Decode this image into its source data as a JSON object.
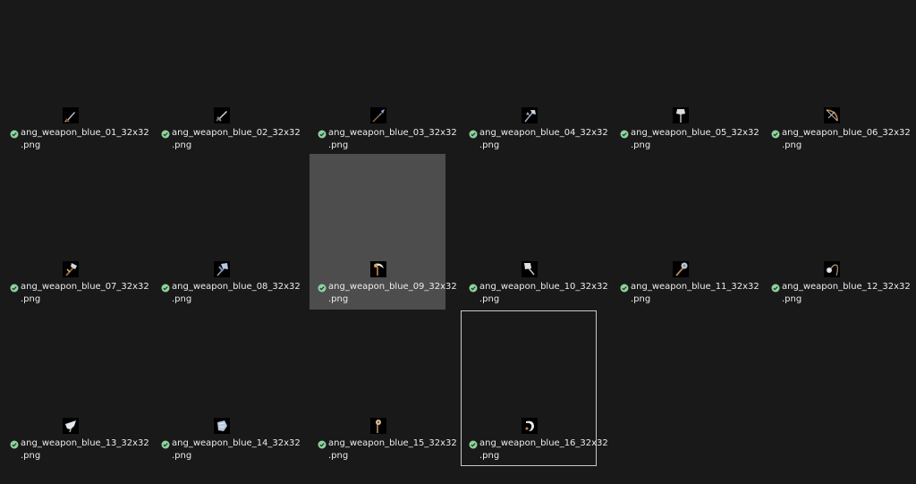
{
  "colors": {
    "background": "#191919",
    "selected_tile": "#4d4d4d",
    "focus_border": "#c8c8c8",
    "text": "#ececec",
    "sync_check": "#8fd19e"
  },
  "files": [
    {
      "line1": "ang_weapon_blue_01_32x32",
      "line2": ".png",
      "icon": "dagger-icon",
      "status_icon": "synced-check-icon"
    },
    {
      "line1": "ang_weapon_blue_02_32x32",
      "line2": ".png",
      "icon": "sword-icon",
      "status_icon": "synced-check-icon"
    },
    {
      "line1": "ang_weapon_blue_03_32x32",
      "line2": ".png",
      "icon": "spear-icon",
      "status_icon": "synced-check-icon"
    },
    {
      "line1": "ang_weapon_blue_04_32x32",
      "line2": ".png",
      "icon": "double-axe-icon",
      "status_icon": "synced-check-icon"
    },
    {
      "line1": "ang_weapon_blue_05_32x32",
      "line2": ".png",
      "icon": "war-axe-icon",
      "status_icon": "synced-check-icon"
    },
    {
      "line1": "ang_weapon_blue_06_32x32",
      "line2": ".png",
      "icon": "bow-icon",
      "status_icon": "synced-check-icon"
    },
    {
      "line1": "ang_weapon_blue_07_32x32",
      "line2": ".png",
      "icon": "hand-axe-icon",
      "status_icon": "synced-check-icon"
    },
    {
      "line1": "ang_weapon_blue_08_32x32",
      "line2": ".png",
      "icon": "battle-axe-icon",
      "status_icon": "synced-check-icon"
    },
    {
      "line1": "ang_weapon_blue_09_32x32",
      "line2": ".png",
      "icon": "scythe-icon",
      "status_icon": "synced-check-icon",
      "selected": true
    },
    {
      "line1": "ang_weapon_blue_10_32x32",
      "line2": ".png",
      "icon": "great-axe-icon",
      "status_icon": "synced-check-icon"
    },
    {
      "line1": "ang_weapon_blue_11_32x32",
      "line2": ".png",
      "icon": "mace-icon",
      "status_icon": "synced-check-icon"
    },
    {
      "line1": "ang_weapon_blue_12_32x32",
      "line2": ".png",
      "icon": "flail-icon",
      "status_icon": "synced-check-icon"
    },
    {
      "line1": "ang_weapon_blue_13_32x32",
      "line2": ".png",
      "icon": "claw-icon",
      "status_icon": "synced-check-icon"
    },
    {
      "line1": "ang_weapon_blue_14_32x32",
      "line2": ".png",
      "icon": "gauntlet-icon",
      "status_icon": "synced-check-icon"
    },
    {
      "line1": "ang_weapon_blue_15_32x32",
      "line2": ".png",
      "icon": "staff-icon",
      "status_icon": "synced-check-icon"
    },
    {
      "line1": "ang_weapon_blue_16_32x32",
      "line2": ".png",
      "icon": "sickle-icon",
      "status_icon": "synced-check-icon",
      "focused": true
    }
  ]
}
